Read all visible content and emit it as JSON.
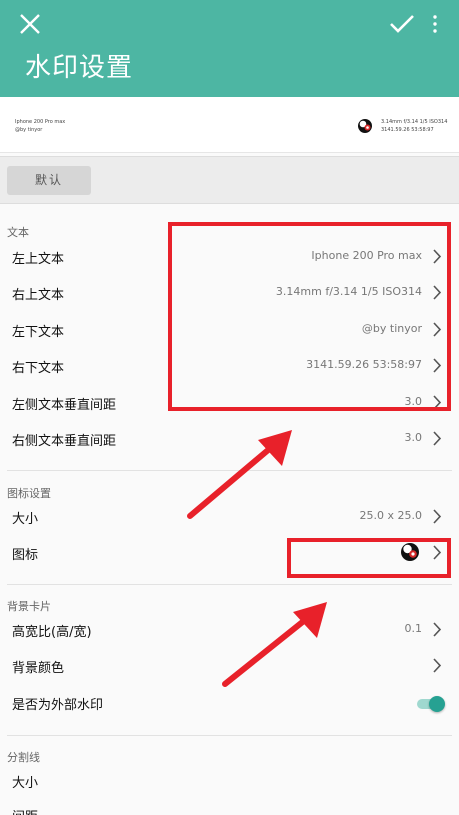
{
  "appbar": {
    "title": "水印设置",
    "bg_color": "#4db6a3",
    "icons": [
      "close-icon",
      "check-icon",
      "more-vert-icon"
    ]
  },
  "preview": {
    "top_left": "Iphone 200 Pro max",
    "bottom_left": "@by tinyor",
    "top_right": "3.14mm f/3.14 1/5 ISO314",
    "bottom_right": "3141.59.26 53:58:97"
  },
  "defaults_button": "默认",
  "sections": {
    "text": {
      "header": "文本",
      "rows": [
        {
          "label": "左上文本",
          "value": "Iphone 200 Pro max"
        },
        {
          "label": "右上文本",
          "value": "3.14mm f/3.14 1/5 ISO314"
        },
        {
          "label": "左下文本",
          "value": "@by tinyor"
        },
        {
          "label": "右下文本",
          "value": "3141.59.26 53:58:97"
        },
        {
          "label": "左侧文本垂直间距",
          "value": "3.0"
        },
        {
          "label": "右侧文本垂直间距",
          "value": "3.0"
        }
      ]
    },
    "icon": {
      "header": "图标设置",
      "rows": [
        {
          "label": "大小",
          "value": "25.0 x 25.0"
        },
        {
          "label": "图标",
          "value": ""
        }
      ]
    },
    "card": {
      "header": "背景卡片",
      "rows": [
        {
          "label": "高宽比(高/宽)",
          "value": "0.1"
        },
        {
          "label": "背景颜色",
          "value": ""
        },
        {
          "label": "是否为外部水印",
          "toggle_on": true
        }
      ]
    },
    "divider_line": {
      "header": "分割线",
      "rows": [
        {
          "label": "大小"
        },
        {
          "label": "间距"
        }
      ]
    }
  },
  "annotation_color": "#e8212a",
  "accent_color": "#26a192"
}
